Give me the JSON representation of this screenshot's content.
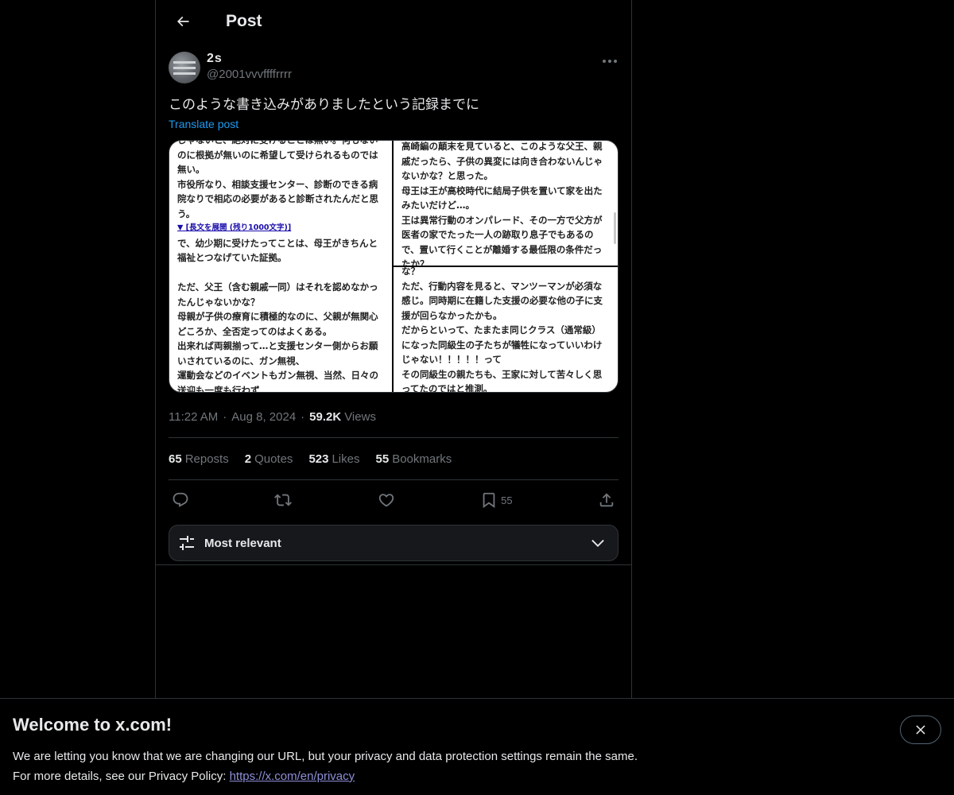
{
  "header": {
    "title": "Post"
  },
  "post": {
    "author": {
      "display_name": "2s",
      "handle": "@2001vvvffffrrrr"
    },
    "text": "このような書き込みがありましたという記録までに",
    "translate_label": "Translate post",
    "media": {
      "left_lines": [
        "じゃないと、絶対に受けることは無い。何もない",
        "のに根拠が無いのに希望して受けられるものでは",
        "無い。",
        "市役所なり、相談支援センター、診断のできる病",
        "院なりで相応の必要があると診断されたんだと思",
        "う。",
        "▼ [長文を展開 (残り1000文字)]",
        "で、幼少期に受けたってことは、母王がきちんと",
        "福祉とつなげていた証拠。",
        "",
        "ただ、父王（含む親戚一同）はそれを認めなかっ",
        "たんじゃないかな？",
        "母親が子供の療育に積極的なのに、父親が無関心",
        "どころか、全否定ってのはよくある。",
        "出来れば両親揃って…と支援センター側からお願",
        "いされているのに、ガン無視、",
        "運動会などのイベントもガン無視、当然、日々の",
        "送迎も一度も行わず"
      ],
      "right_top_lines": [
        "高崎編の顛末を見ていると、このような父王、親",
        "戚だったら、子供の異変には向き合わないんじゃ",
        "ないかな？と思った。",
        "母王は王が高校時代に結局子供を置いて家を出た",
        "みたいだけど…。",
        "王は異常行動のオンパレード、その一方で父方が",
        "医者の家でたった一人の跡取り息子でもあるの",
        "で、置いて行くことが離婚する最低限の条件だっ",
        "たか？"
      ],
      "right_bottom_lines": [
        "な？",
        "ただ、行動内容を見ると、マンツーマンが必須な",
        "感じ。同時期に在籍した支援の必要な他の子に支",
        "援が回らなかったかも。",
        "だからといって、たまたま同じクラス（通常級）",
        "になった同級生の子たちが犠牲になっていいわけ",
        "じゃない！！！！！って",
        "その同級生の親たちも、王家に対して苦々しく思",
        "ってたのではと推測。"
      ]
    },
    "time": "11:22 AM",
    "date": "Aug 8, 2024",
    "views_count": "59.2K",
    "views_label": "Views",
    "stats": {
      "reposts_count": "65",
      "reposts_label": "Reposts",
      "quotes_count": "2",
      "quotes_label": "Quotes",
      "likes_count": "523",
      "likes_label": "Likes",
      "bookmarks_count": "55",
      "bookmarks_label": "Bookmarks"
    },
    "actions": {
      "bookmark_count": "55"
    }
  },
  "sort": {
    "label": "Most relevant"
  },
  "banner": {
    "title": "Welcome to x.com!",
    "line1": "We are letting you know that we are changing our URL, but your privacy and data protection settings remain the same.",
    "line2_prefix": "For more details, see our Privacy Policy: ",
    "link": "https://x.com/en/privacy"
  },
  "colors": {
    "background": "#000000",
    "accent": "#1d9bf0",
    "muted": "#71767b",
    "text": "#e7e9ea"
  }
}
